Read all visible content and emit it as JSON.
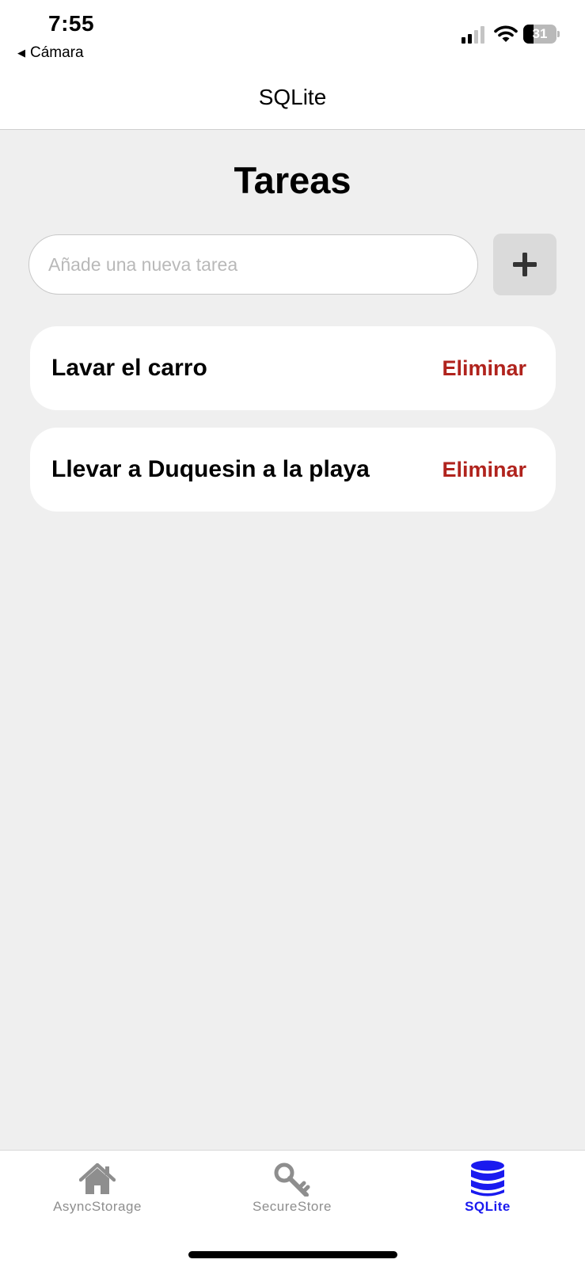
{
  "status_bar": {
    "time": "7:55",
    "back_app": "Cámara",
    "battery_level": "31",
    "battery_fraction": 0.31
  },
  "header": {
    "title": "SQLite"
  },
  "main": {
    "title": "Tareas",
    "input": {
      "placeholder": "Añade una nueva tarea",
      "value": ""
    },
    "add_button_label": "+",
    "tasks": [
      {
        "text": "Lavar el carro",
        "delete_label": "Eliminar"
      },
      {
        "text": "Llevar a Duquesin a la playa",
        "delete_label": "Eliminar"
      }
    ]
  },
  "tab_bar": {
    "tabs": [
      {
        "label": "AsyncStorage",
        "icon": "home-icon",
        "active": false
      },
      {
        "label": "SecureStore",
        "icon": "key-icon",
        "active": false
      },
      {
        "label": "SQLite",
        "icon": "database-icon",
        "active": true
      }
    ]
  },
  "colors": {
    "accent": "#1a1aef",
    "delete": "#b0231d",
    "background": "#efefef",
    "inactive_tab": "#8e8e8e"
  }
}
